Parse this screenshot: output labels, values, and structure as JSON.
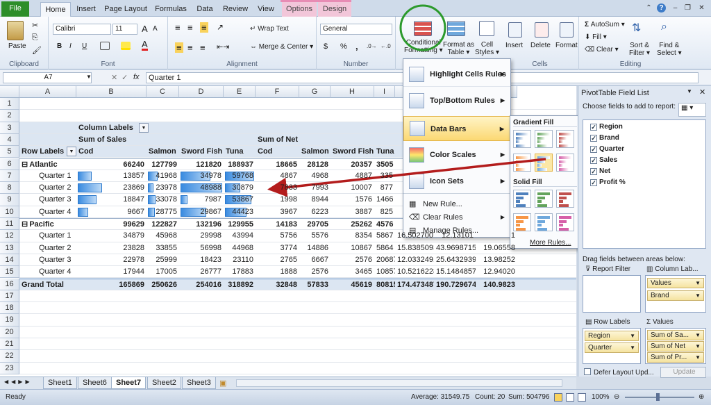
{
  "ribbon_tabs": [
    "File",
    "Home",
    "Insert",
    "Page Layout",
    "Formulas",
    "Data",
    "Review",
    "View",
    "Options",
    "Design"
  ],
  "clipboard": {
    "paste": "Paste",
    "group": "Clipboard"
  },
  "font": {
    "name": "Calibri",
    "size": "11",
    "bold": "B",
    "italic": "I",
    "underline": "U",
    "group": "Font"
  },
  "alignment": {
    "wrap": "Wrap Text",
    "merge": "Merge & Center",
    "group": "Alignment"
  },
  "number": {
    "format": "General",
    "currency": "$",
    "percent": "%",
    "comma": ",",
    "group": "Number"
  },
  "styles": {
    "conditional_1": "Conditional",
    "conditional_2": "Formatting",
    "format_as_1": "Format as",
    "format_as_2": "Table",
    "cell_1": "Cell",
    "cell_2": "Styles"
  },
  "cells": {
    "insert": "Insert",
    "delete": "Delete",
    "format": "Format",
    "group": "Cells"
  },
  "editing": {
    "autosum": "AutoSum",
    "fill": "Fill",
    "clear": "Clear",
    "sort_1": "Sort &",
    "sort_2": "Filter",
    "find_1": "Find &",
    "find_2": "Select",
    "group": "Editing"
  },
  "formula_bar": {
    "name_box": "A7",
    "fx": "fx",
    "value": "Quarter 1"
  },
  "columns": [
    "A",
    "B",
    "C",
    "D",
    "E",
    "F",
    "G",
    "H",
    "I",
    "J",
    "K",
    "L"
  ],
  "rows": [
    "1",
    "2",
    "3",
    "4",
    "5",
    "6",
    "7",
    "8",
    "9",
    "10",
    "11",
    "12",
    "13",
    "14",
    "15",
    "16",
    "17",
    "18",
    "19",
    "20",
    "21",
    "22",
    "23"
  ],
  "pivot": {
    "col_labels": "Column Labels",
    "sum_sales": "Sum of Sales",
    "sum_net": "Sum of Net",
    "row_labels": "Row Labels",
    "headers": [
      "Cod",
      "Salmon",
      "Sword Fish",
      "Tuna",
      "Cod",
      "Salmon",
      "Sword Fish",
      "Tuna"
    ],
    "rows": [
      {
        "label": "Atlantic",
        "type": "group",
        "v": [
          "66240",
          "127799",
          "121820",
          "188937",
          "18665",
          "28128",
          "20357",
          "3505",
          "",
          "",
          ""
        ]
      },
      {
        "label": "Quarter 1",
        "type": "item",
        "v": [
          "13857",
          "41968",
          "34978",
          "59768",
          "4867",
          "4968",
          "4887",
          "335",
          "",
          "",
          ""
        ]
      },
      {
        "label": "Quarter 2",
        "type": "item",
        "v": [
          "23869",
          "23978",
          "48988",
          "30879",
          "7833",
          "7993",
          "10007",
          "877",
          "",
          "",
          ""
        ]
      },
      {
        "label": "Quarter 3",
        "type": "item",
        "v": [
          "18847",
          "33078",
          "7987",
          "53867",
          "1998",
          "8944",
          "1576",
          "1466",
          "",
          "",
          ""
        ]
      },
      {
        "label": "Quarter 4",
        "type": "item",
        "v": [
          "9667",
          "28775",
          "29867",
          "44423",
          "3967",
          "6223",
          "3887",
          "825",
          "",
          "",
          ""
        ]
      },
      {
        "label": "Pacific",
        "type": "group",
        "v": [
          "99629",
          "122827",
          "132196",
          "129955",
          "14183",
          "29705",
          "25262",
          "4576",
          "",
          "",
          ""
        ]
      },
      {
        "label": "Quarter 1",
        "type": "item",
        "v": [
          "34879",
          "45968",
          "29998",
          "43994",
          "5756",
          "5576",
          "8354",
          "5867",
          "16.50270071",
          "12.13101",
          "1"
        ]
      },
      {
        "label": "Quarter 2",
        "type": "item",
        "v": [
          "23828",
          "33855",
          "56998",
          "44968",
          "3774",
          "14886",
          "10867",
          "5864",
          "15.83850932",
          "43.9698715",
          "19.06558"
        ]
      },
      {
        "label": "Quarter 3",
        "type": "item",
        "v": [
          "22978",
          "25999",
          "18423",
          "23110",
          "2765",
          "6667",
          "2576",
          "20687",
          "12.03324919",
          "25.64329397",
          "13.98252"
        ]
      },
      {
        "label": "Quarter 4",
        "type": "item",
        "v": [
          "17944",
          "17005",
          "26777",
          "17883",
          "1888",
          "2576",
          "3465",
          "10857",
          "10.52162283",
          "15.14848574",
          "12.94020"
        ]
      },
      {
        "label": "Grand Total",
        "type": "total",
        "v": [
          "165869",
          "250626",
          "254016",
          "318892",
          "32848",
          "57833",
          "45619",
          "80815",
          "174.4734873",
          "190.7296743",
          "140.9823"
        ]
      }
    ],
    "bars": {
      "b": [
        0.21,
        0.36,
        0.28,
        0.15
      ],
      "c": [
        0.33,
        0.19,
        0.26,
        0.23
      ],
      "d": [
        0.71,
        1.0,
        0.16,
        0.61
      ],
      "e": [
        1.0,
        0.52,
        0.9,
        0.74
      ]
    }
  },
  "cf_menu": {
    "items": [
      "Highlight Cells Rules",
      "Top/Bottom Rules",
      "Data Bars",
      "Color Scales",
      "Icon Sets"
    ],
    "new": "New Rule...",
    "clear": "Clear Rules",
    "manage": "Manage Rules..."
  },
  "databars_menu": {
    "gradient": "Gradient Fill",
    "solid": "Solid Fill",
    "more": "More Rules...",
    "colors": [
      "#4f81bd",
      "#63a35c",
      "#c0504d",
      "#f79646",
      "#6fa8dc",
      "#d65fa8"
    ]
  },
  "field_list": {
    "title": "PivotTable Field List",
    "choose": "Choose fields to add to report:",
    "fields": [
      "Region",
      "Brand",
      "Quarter",
      "Sales",
      "Net",
      "Profit %"
    ],
    "drag": "Drag fields between areas below:",
    "report_filter": "Report Filter",
    "column_labels": "Column Lab...",
    "row_labels": "Row Labels",
    "values": "Values",
    "col_items": [
      "Values",
      "Brand"
    ],
    "row_items": [
      "Region",
      "Quarter"
    ],
    "val_items": [
      "Sum of Sa...",
      "Sum of Net",
      "Sum of Pr..."
    ],
    "defer": "Defer Layout Upd...",
    "update": "Update"
  },
  "sheets": [
    "Sheet1",
    "Sheet6",
    "Sheet7",
    "Sheet2",
    "Sheet3"
  ],
  "status": {
    "ready": "Ready",
    "average": "Average: 31549.75",
    "count": "Count: 20",
    "sum": "Sum: 504796",
    "zoom": "100%"
  }
}
